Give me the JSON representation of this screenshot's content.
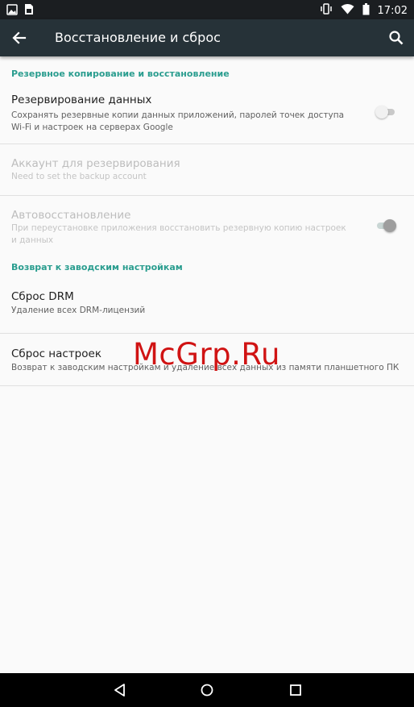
{
  "status": {
    "time": "17:02",
    "left_icons": [
      "image-icon",
      "sim-card-icon"
    ],
    "right_icons": [
      "vibrate-icon",
      "wifi-icon",
      "battery-icon"
    ]
  },
  "appbar": {
    "title": "Восстановление и сброс",
    "back_icon": "arrow-back-icon",
    "search_icon": "search-icon"
  },
  "sections": [
    {
      "header": "Резервное копирование и восстановление",
      "items": [
        {
          "title": "Резервирование данных",
          "subtitle": "Сохранять резервные копии данных приложений, паролей точек доступа Wi-Fi и настроек на серверах Google",
          "toggle": "off",
          "enabled": true
        },
        {
          "title": "Аккаунт для резервирования",
          "subtitle": "Need to set the backup account",
          "enabled": false
        },
        {
          "title": "Автовосстановление",
          "subtitle": "При переустановке приложения восстановить резервную копию настроек и данных",
          "toggle": "on",
          "enabled": false
        }
      ]
    },
    {
      "header": "Возврат к заводским настройкам",
      "items": [
        {
          "title": "Сброс DRM",
          "subtitle": "Удаление всех DRM-лицензий",
          "enabled": true
        },
        {
          "title": "Сброс настроек",
          "subtitle": "Возврат к заводским настройкам и удаление всех данных из памяти планшетного ПК",
          "enabled": true
        }
      ]
    }
  ],
  "watermark": "McGrp.Ru",
  "navbar": {
    "back_icon": "nav-back-icon",
    "home_icon": "nav-home-icon",
    "recents_icon": "nav-recents-icon"
  },
  "colors": {
    "accent": "#2a9d8f",
    "appbar": "#263238",
    "statusbar": "#1b1e21",
    "watermark": "#d01313"
  }
}
